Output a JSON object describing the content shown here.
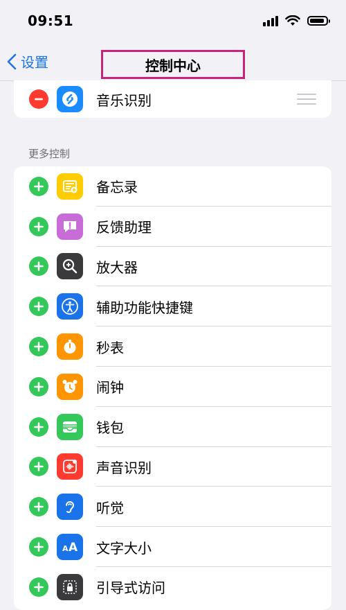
{
  "status_bar": {
    "time": "09:51"
  },
  "nav": {
    "back_label": "设置",
    "title": "控制中心"
  },
  "included": [
    {
      "label": "音乐识别",
      "icon": "shazam-icon",
      "color": "#1a8cff"
    }
  ],
  "more_controls": {
    "header": "更多控制",
    "items": [
      {
        "label": "备忘录",
        "icon": "notes-icon",
        "color": "#ffcc00"
      },
      {
        "label": "反馈助理",
        "icon": "feedback-icon",
        "color": "#c86dd7"
      },
      {
        "label": "放大器",
        "icon": "magnifier-icon",
        "color": "#3a3a3c"
      },
      {
        "label": "辅助功能快捷键",
        "icon": "accessibility-icon",
        "color": "#1a73e8"
      },
      {
        "label": "秒表",
        "icon": "stopwatch-icon",
        "color": "#ff9500"
      },
      {
        "label": "闹钟",
        "icon": "alarm-icon",
        "color": "#ff9500"
      },
      {
        "label": "钱包",
        "icon": "wallet-icon",
        "color": "#34c759"
      },
      {
        "label": "声音识别",
        "icon": "sound-recognition-icon",
        "color": "#ff3b30"
      },
      {
        "label": "听觉",
        "icon": "hearing-icon",
        "color": "#1a73e8"
      },
      {
        "label": "文字大小",
        "icon": "text-size-icon",
        "color": "#1a73e8"
      },
      {
        "label": "引导式访问",
        "icon": "guided-access-icon",
        "color": "#3a3a3c"
      }
    ]
  },
  "colors": {
    "accent": "#1a73e8",
    "add": "#34c759",
    "remove": "#ff3b30",
    "highlight": "#c8237a"
  }
}
